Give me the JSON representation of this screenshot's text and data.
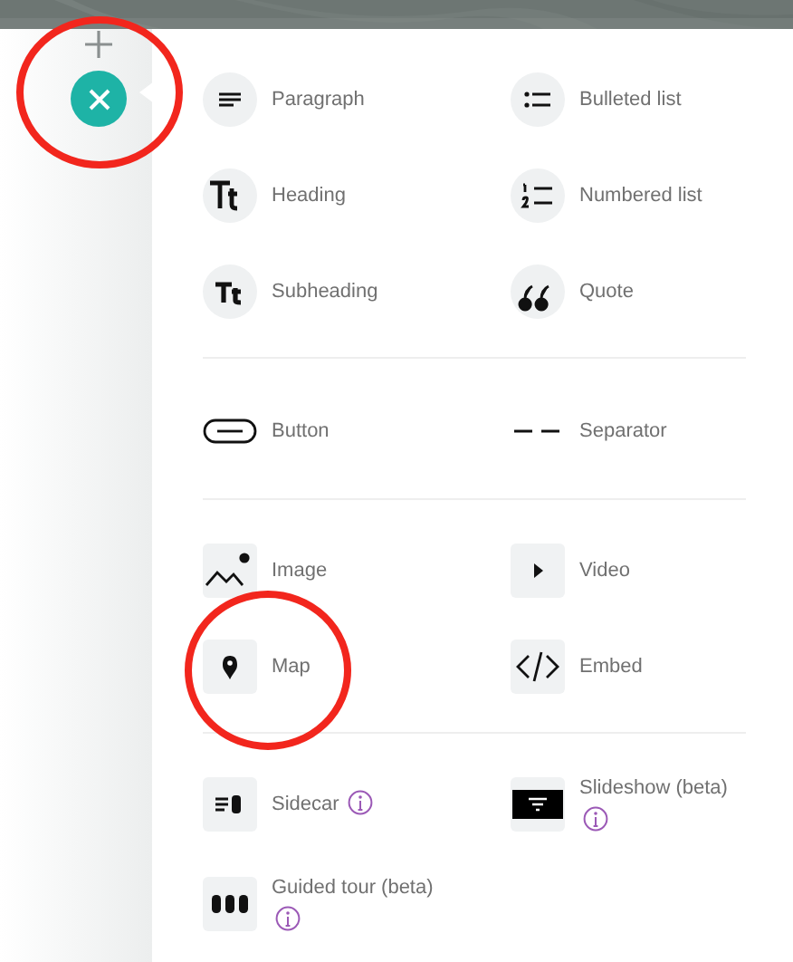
{
  "sections": [
    {
      "items": [
        {
          "label": "Paragraph",
          "info": false
        },
        {
          "label": "Bulleted list",
          "info": false
        },
        {
          "label": "Heading",
          "info": false
        },
        {
          "label": "Numbered list",
          "info": false
        },
        {
          "label": "Subheading",
          "info": false
        },
        {
          "label": "Quote",
          "info": false
        }
      ]
    },
    {
      "items": [
        {
          "label": "Button",
          "info": false
        },
        {
          "label": "Separator",
          "info": false
        }
      ]
    },
    {
      "items": [
        {
          "label": "Image",
          "info": false
        },
        {
          "label": "Video",
          "info": false
        },
        {
          "label": "Map",
          "info": false
        },
        {
          "label": "Embed",
          "info": false
        }
      ]
    },
    {
      "items": [
        {
          "label": "Sidecar",
          "info": true
        },
        {
          "label": "Slideshow (beta)",
          "info": true
        },
        {
          "label": "Guided tour (beta)",
          "info": true
        }
      ]
    }
  ]
}
